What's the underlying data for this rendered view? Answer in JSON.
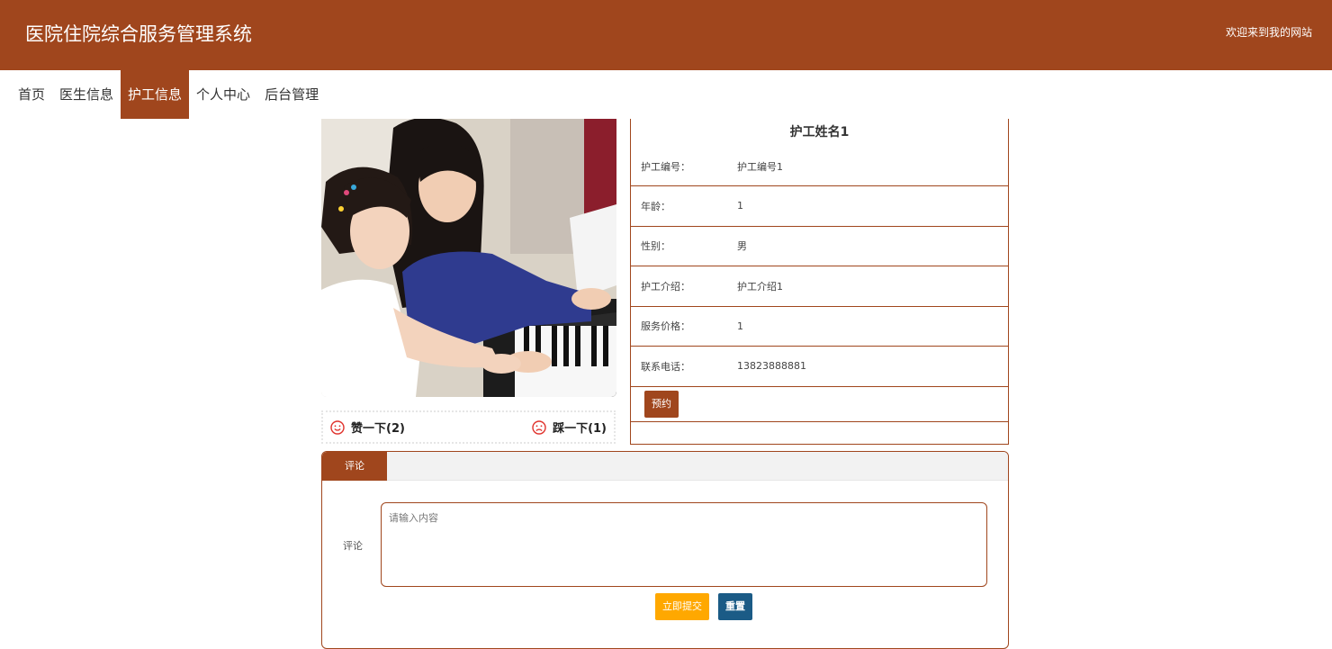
{
  "header": {
    "title": "医院住院综合服务管理系统",
    "welcome": "欢迎来到我的网站"
  },
  "nav": {
    "items": [
      {
        "label": "首页",
        "active": false
      },
      {
        "label": "医生信息",
        "active": false
      },
      {
        "label": "护工信息",
        "active": true
      },
      {
        "label": "个人中心",
        "active": false
      },
      {
        "label": "后台管理",
        "active": false
      }
    ]
  },
  "votes": {
    "like": "赞一下(2)",
    "dislike": "踩一下(1)"
  },
  "detail": {
    "name": "护工姓名1",
    "rows": [
      {
        "label": "护工编号：",
        "value": "护工编号1"
      },
      {
        "label": "年龄：",
        "value": "1"
      },
      {
        "label": "性别：",
        "value": "男"
      },
      {
        "label": "护工介绍：",
        "value": "护工介绍1"
      },
      {
        "label": "服务价格：",
        "value": "1"
      },
      {
        "label": "联系电话：",
        "value": "13823888881"
      }
    ],
    "book_label": "预约"
  },
  "comment": {
    "tab_label": "评论",
    "field_label": "评论",
    "placeholder": "请输入内容",
    "value": "",
    "submit_label": "立即提交",
    "reset_label": "重置"
  },
  "colors": {
    "brand": "#a0461d",
    "submit": "#ffa800",
    "reset": "#1b5b86"
  }
}
